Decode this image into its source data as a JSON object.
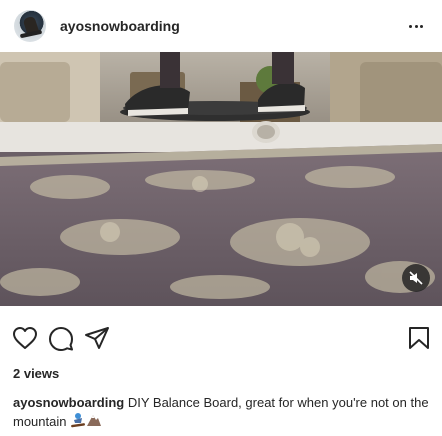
{
  "post": {
    "username": "ayosnowboarding",
    "views_count": "2 views",
    "caption_author": "ayosnowboarding",
    "caption_text": " DIY Balance Board, great for when you're not on the mountain ",
    "caption_emojis": [
      "snowboarder-emoji",
      "mountain-emoji"
    ]
  },
  "icons": {
    "more": "more-horizontal-icon",
    "like": "heart-icon",
    "comment": "comment-icon",
    "share": "share-icon",
    "save": "bookmark-icon",
    "mute": "muted-speaker-icon"
  },
  "colors": {
    "text": "#262626",
    "rug": "#6d6068",
    "rug_pattern": "#c9c1a8"
  }
}
